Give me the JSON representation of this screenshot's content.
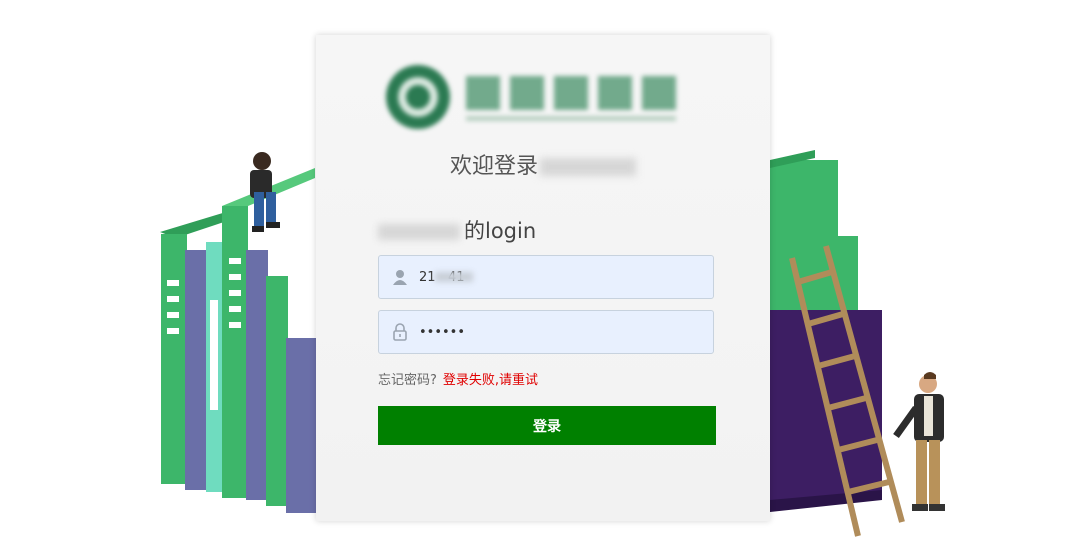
{
  "header": {
    "welcome_text": "欢迎登录",
    "login_text": "的login"
  },
  "form": {
    "username_value": "21   41",
    "password_value": "••••••",
    "forgot_label": "忘记密码?",
    "error_text": "登录失败,请重试",
    "submit_label": "登录"
  },
  "colors": {
    "button_bg": "#008000",
    "error_text": "#e00000",
    "field_bg": "#e8f0fe"
  },
  "icons": [
    "user-icon",
    "lock-icon"
  ]
}
